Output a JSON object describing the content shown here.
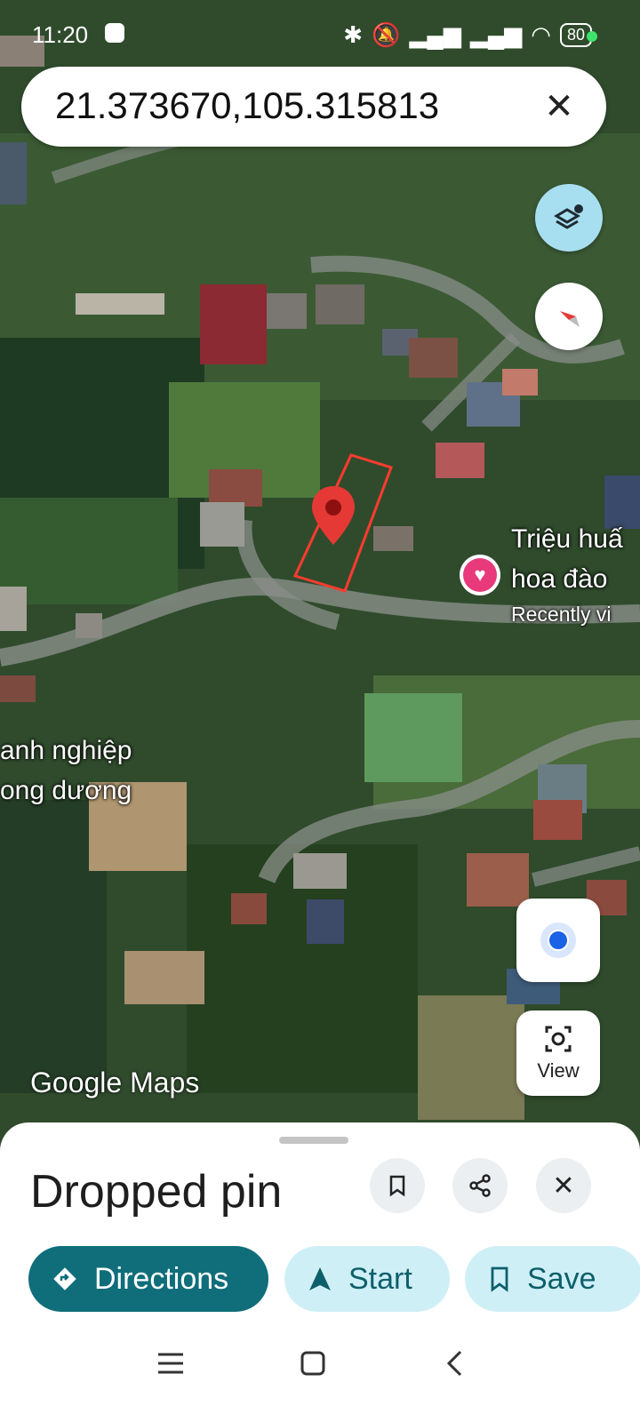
{
  "status_bar": {
    "time": "11:20",
    "battery": "80"
  },
  "search": {
    "query": "21.373670,105.315813"
  },
  "map_labels": {
    "poi_name_line1": "Triệu huấ",
    "poi_name_line2": "hoa đào",
    "poi_sub": "Recently vi",
    "place_line1": "anh nghiệp",
    "place_line2": "ong dương"
  },
  "map_buttons": {
    "view_label": "View"
  },
  "logo": {
    "text": "Google Maps"
  },
  "sheet": {
    "title": "Dropped pin",
    "directions_label": "Directions",
    "start_label": "Start",
    "save_label": "Save"
  },
  "colors": {
    "primary": "#0f6e7a",
    "chip_bg": "#cfeff6",
    "pin_red": "#e53935"
  }
}
